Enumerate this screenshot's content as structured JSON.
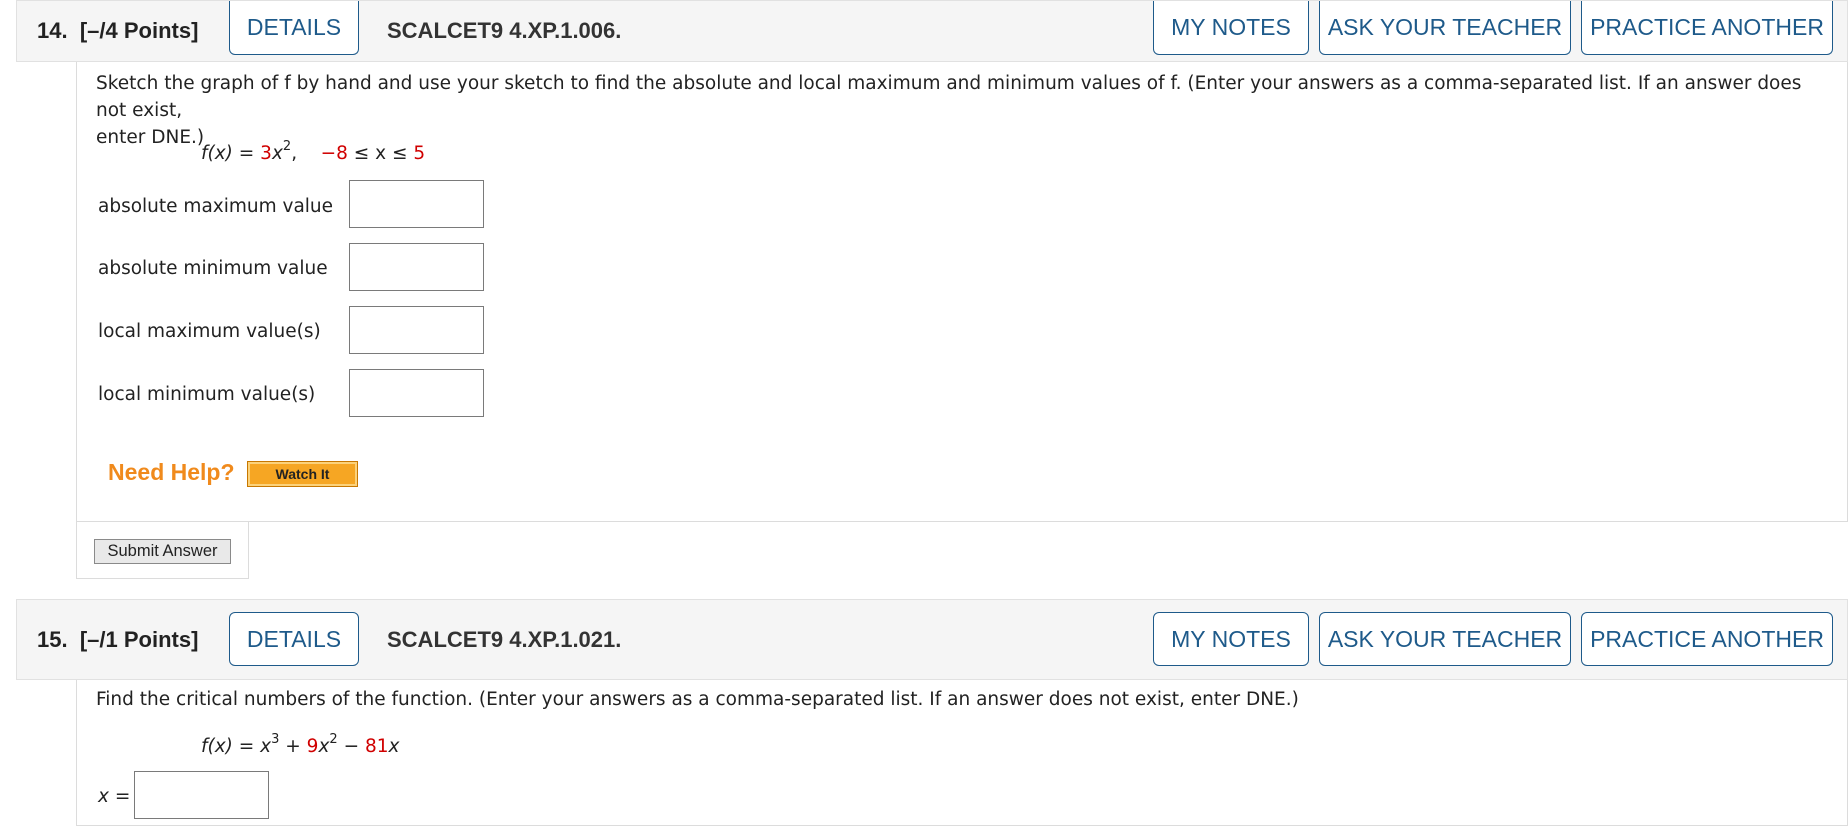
{
  "q14": {
    "number": "14.",
    "points": "[–/4 Points]",
    "details": "DETAILS",
    "code": "SCALCET9 4.XP.1.006.",
    "my_notes": "MY NOTES",
    "ask_teacher": "ASK YOUR TEACHER",
    "practice": "PRACTICE ANOTHER",
    "prompt_line1": "Sketch the graph of f by hand and use your sketch to find the absolute and local maximum and minimum values of f. (Enter your answers as a comma-separated list. If an answer does not exist,",
    "prompt_line2": "enter DNE.)",
    "formula": {
      "lhs": "f(x) = ",
      "coef": "3",
      "var": "x",
      "exp": "2",
      "sep": ",",
      "lower": "−8",
      "mid": " ≤ x ≤ ",
      "upper": "5"
    },
    "answers": [
      {
        "label": "absolute maximum value",
        "value": ""
      },
      {
        "label": "absolute minimum value",
        "value": ""
      },
      {
        "label": "local maximum value(s)",
        "value": ""
      },
      {
        "label": "local minimum value(s)",
        "value": ""
      }
    ],
    "need_help": "Need Help?",
    "watch_it": "Watch It",
    "submit": "Submit Answer"
  },
  "q15": {
    "number": "15.",
    "points": "[–/1 Points]",
    "details": "DETAILS",
    "code": "SCALCET9 4.XP.1.021.",
    "my_notes": "MY NOTES",
    "ask_teacher": "ASK YOUR TEACHER",
    "practice": "PRACTICE ANOTHER",
    "prompt": "Find the critical numbers of the function. (Enter your answers as a comma-separated list. If an answer does not exist, enter DNE.)",
    "formula": {
      "lhs": "f(x) = ",
      "t1": "x",
      "e1": "3",
      "plus": " + ",
      "c2": "9",
      "t2": "x",
      "e2": "2",
      "minus": " − ",
      "c3": "81",
      "t3": "x"
    },
    "answer_label": "x =",
    "answer_value": ""
  },
  "colors": {
    "button_blue": "#1e5a8a",
    "coefficient_red": "#d00000",
    "help_orange": "#f08a1c"
  }
}
